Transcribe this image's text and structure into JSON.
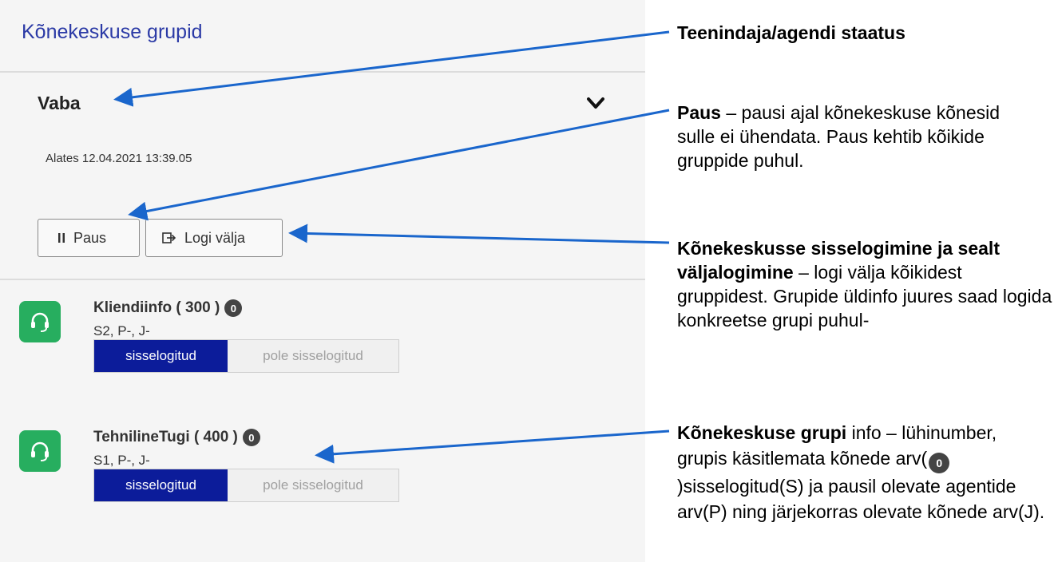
{
  "panel": {
    "title": "Kõnekeskuse grupid",
    "status": "Vaba",
    "since": "Alates 12.04.2021 13:39.05",
    "buttons": {
      "pause": "Paus",
      "logout": "Logi välja"
    }
  },
  "groups": [
    {
      "name": "Kliendiinfo ( 300 )",
      "badge": "0",
      "stats": "S2, P-, J-",
      "logged_in": "sisselogitud",
      "not_logged_in": "pole sisselogitud"
    },
    {
      "name": "TehnilineTugi ( 400 )",
      "badge": "0",
      "stats": "S1, P-, J-",
      "logged_in": "sisselogitud",
      "not_logged_in": "pole sisselogitud"
    }
  ],
  "annotations": {
    "status": {
      "bold": "Teenindaja/agendi staatus"
    },
    "pause": {
      "bold": "Paus",
      "text": " – pausi ajal kõnekeskuse kõnesid sulle ei ühendata. Paus kehtib kõikide gruppide puhul."
    },
    "login": {
      "bold": "Kõnekeskusse sisselogimine ja sealt väljalogimine",
      "text": " – logi välja kõikidest gruppidest. Grupide üldinfo juures saad logida konkreetse grupi puhul-"
    },
    "group": {
      "bold": "Kõnekeskuse grupi",
      "text1": " info – lühinumber, grupis käsitlemata kõnede arv(",
      "badge": "0",
      "text2": ")sisselogitud(S) ja pausil olevate agentide arv(P) ning järjekorras olevate kõnede arv(J)."
    }
  },
  "colors": {
    "arrow": "#1a66cc",
    "primary": "#0c1c9a",
    "headset": "#27ae5f"
  }
}
